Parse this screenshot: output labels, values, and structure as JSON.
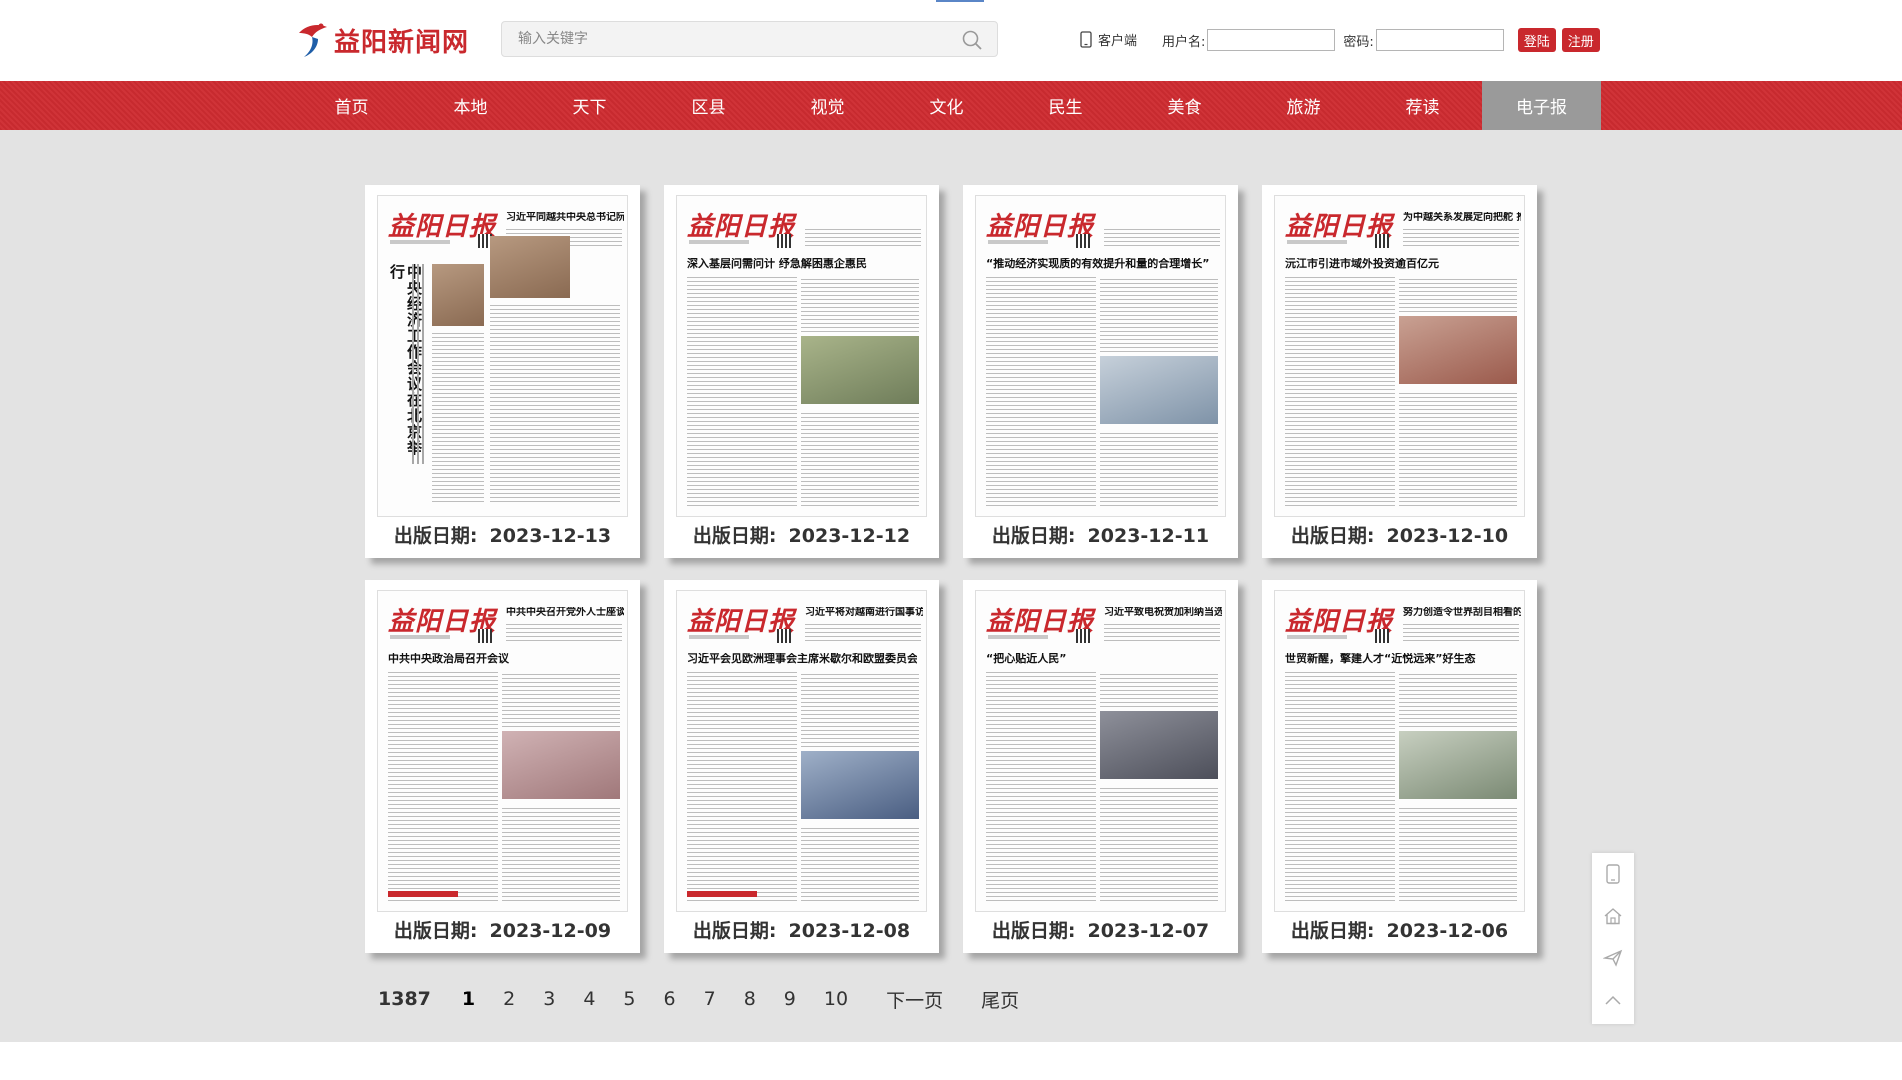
{
  "header": {
    "logo_text": "益阳新闻网",
    "search_placeholder": "输入关键字",
    "client_label": "客户端",
    "username_label": "用户名:",
    "password_label": "密码:",
    "login_label": "登陆",
    "register_label": "注册"
  },
  "nav": {
    "items": [
      "首页",
      "本地",
      "天下",
      "区县",
      "视觉",
      "文化",
      "民生",
      "美食",
      "旅游",
      "荐读",
      "电子报"
    ],
    "active_index": 10
  },
  "papers": {
    "masthead": "益阳日报",
    "date_label": "出版日期:",
    "items": [
      {
        "date": "2023-12-13",
        "headline_main": "中央经济工作会议在北京举行",
        "headline_top": "习近平同越共中央总书记阮富仲举行会谈"
      },
      {
        "date": "2023-12-12",
        "headline_main": "深入基层问需问计 纾急解困惠企惠民",
        "headline_top": ""
      },
      {
        "date": "2023-12-11",
        "headline_main": "“推动经济实现质的有效提升和量的合理增长”",
        "headline_top": ""
      },
      {
        "date": "2023-12-10",
        "headline_main": "沅江市引进市域外投资逾百亿元",
        "headline_top": "为中越关系发展定向把舵 推动亚太共同发展繁荣"
      },
      {
        "date": "2023-12-09",
        "headline_main": "中共中央政治局召开会议",
        "headline_top": "中共中央召开党外人士座谈会"
      },
      {
        "date": "2023-12-08",
        "headline_main": "习近平会见欧洲理事会主席米歇尔和欧盟委员会主席冯德莱恩",
        "headline_top": "习近平将对越南进行国事访问"
      },
      {
        "date": "2023-12-07",
        "headline_main": "“把心贴近人民”",
        "headline_top": "习近平致电祝贺加利纳当选连任马达加斯加总统"
      },
      {
        "date": "2023-12-06",
        "headline_main": "世贸新醒，擎建人才“近悦远来”好生态",
        "headline_top": "努力创造令世界刮目相看的新奇迹"
      }
    ]
  },
  "pagination": {
    "total": "1387",
    "pages": [
      "1",
      "2",
      "3",
      "4",
      "5",
      "6",
      "7",
      "8",
      "9",
      "10"
    ],
    "current": "1",
    "next_label": "下一页",
    "last_label": "尾页"
  },
  "colors": {
    "brand_red": "#c9282d",
    "nav_active": "#9a9a9a",
    "background": "#e3e3e3"
  },
  "icons": {
    "side_tools": [
      "mobile-icon",
      "home-icon",
      "send-icon",
      "arrow-up-icon"
    ]
  }
}
